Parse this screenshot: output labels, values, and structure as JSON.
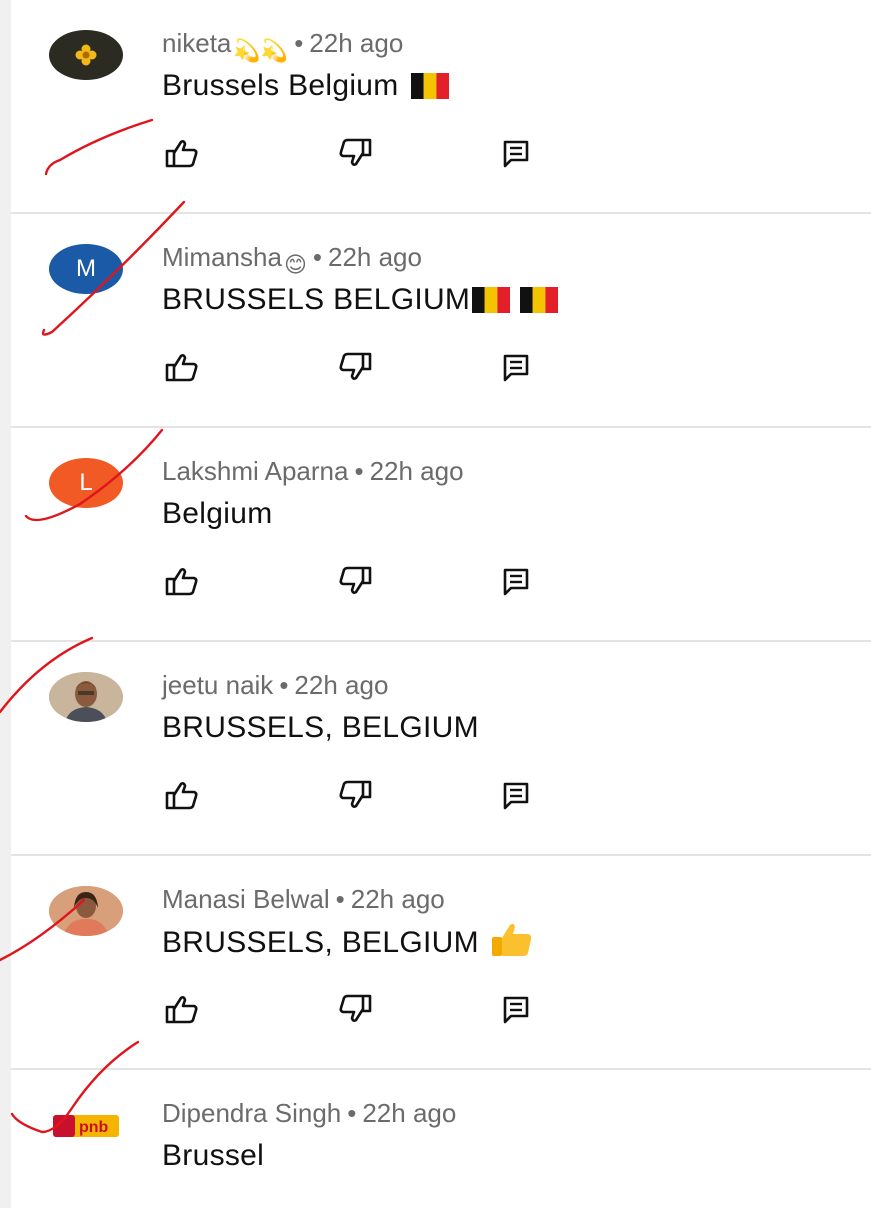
{
  "comments": [
    {
      "author": "niketa",
      "author_emoji": "💫💫",
      "time": "22h ago",
      "text": "Brussels Belgium",
      "text_emoji": "🇧🇪",
      "avatar": {
        "type": "image",
        "color": "#2b2b22",
        "accent": "#f0b81a"
      }
    },
    {
      "author": "Mimansha",
      "author_emoji": "😊",
      "time": "22h ago",
      "text": "BRUSSELS BELGIUM",
      "text_emoji": "🇧🇪🇧🇪",
      "avatar": {
        "type": "letter",
        "letter": "M",
        "color": "#1a5aa6"
      }
    },
    {
      "author": "Lakshmi Aparna",
      "time": "22h ago",
      "text": "Belgium",
      "avatar": {
        "type": "letter",
        "letter": "L",
        "color": "#f15a24"
      }
    },
    {
      "author": "jeetu naik",
      "time": "22h ago",
      "text": "BRUSSELS, BELGIUM",
      "avatar": {
        "type": "image",
        "color": "#c9b59c"
      }
    },
    {
      "author": "Manasi Belwal",
      "time": "22h ago",
      "text": "BRUSSELS, BELGIUM",
      "text_emoji": "👍",
      "avatar": {
        "type": "image",
        "color": "#d7a07a"
      }
    },
    {
      "author": "Dipendra Singh",
      "time": "22h ago",
      "text": "Brussel",
      "avatar": {
        "type": "image",
        "color": "#ffffff",
        "label": "pnb"
      }
    }
  ],
  "meta_separator": "•",
  "icons": {
    "like": "thumbs-up-icon",
    "dislike": "thumbs-down-icon",
    "reply": "reply-comment-icon"
  },
  "colors": {
    "meta_text": "#6b6b6b",
    "comment_text": "#111111",
    "divider": "#e3e3e3",
    "annotation_ink": "#e0151c"
  }
}
